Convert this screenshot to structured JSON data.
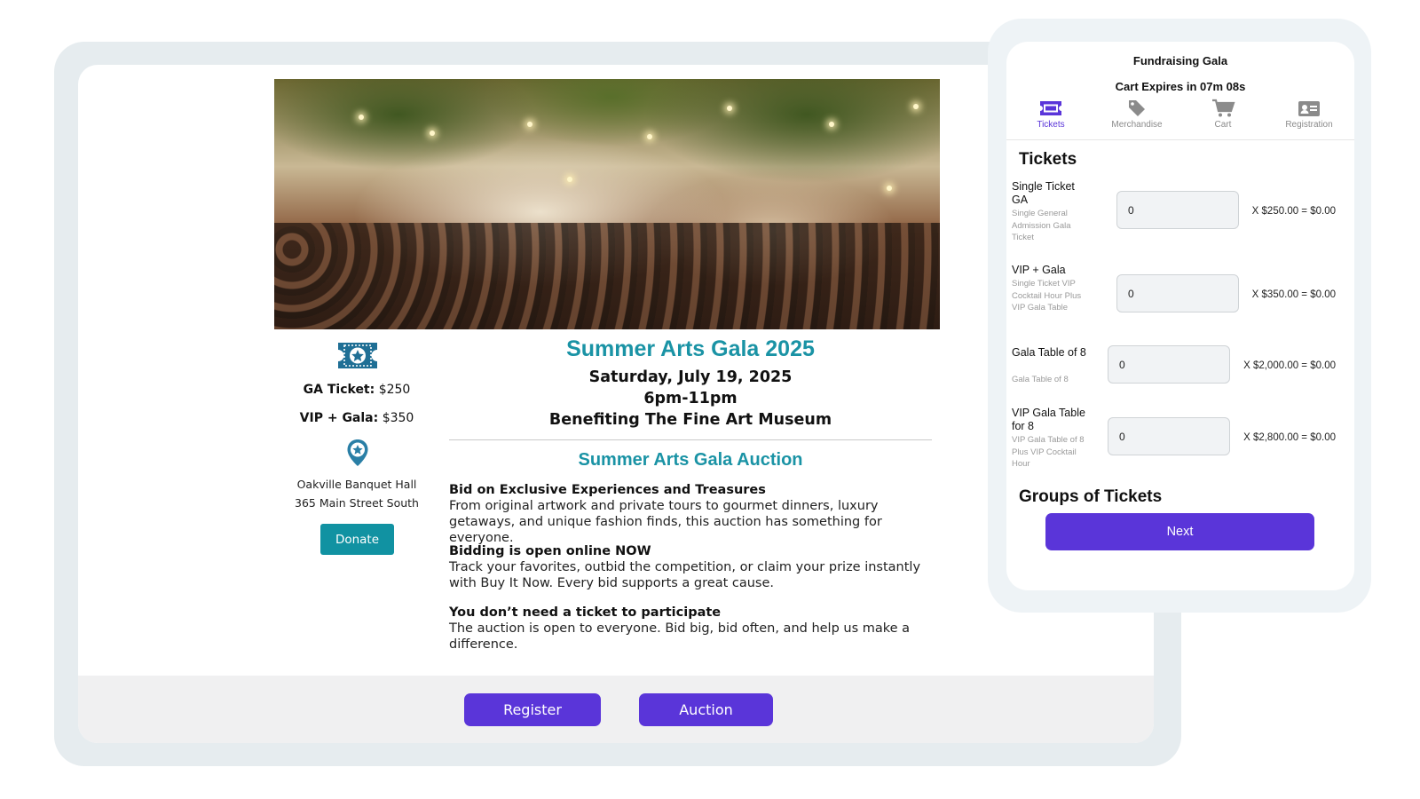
{
  "event": {
    "ga_ticket_label": "GA Ticket:",
    "ga_ticket_price": "$250",
    "vip_gala_label": "VIP + Gala:",
    "vip_gala_price": "$350",
    "venue_name": "Oakville Banquet Hall",
    "venue_address": "365 Main Street South",
    "donate_label": "Donate",
    "title": "Summer Arts Gala 2025",
    "date": "Saturday, July 19, 2025",
    "time": "6pm-11pm",
    "benefit": "Benefiting The Fine Art Museum",
    "auction_title": "Summer Arts Gala Auction",
    "paragraphs": [
      {
        "heading": "Bid on Exclusive Experiences and Treasures",
        "body": "From original artwork and private tours to gourmet dinners, luxury getaways, and unique fashion finds, this auction has something for everyone."
      },
      {
        "heading": "Bidding is open online NOW",
        "body": "Track your favorites, outbid the competition, or claim your prize instantly with Buy It Now. Every bid supports a great cause."
      },
      {
        "heading": "You don’t need a ticket to participate",
        "body": "The auction is open to everyone. Bid big, bid often, and help us make a difference."
      }
    ],
    "register_label": "Register",
    "auction_label": "Auction"
  },
  "widget": {
    "title": "Fundraising Gala",
    "cart_expiry": "Cart Expires in 07m 08s",
    "tabs": [
      {
        "label": "Tickets",
        "icon": "ticket-icon"
      },
      {
        "label": "Merchandise",
        "icon": "tag-icon"
      },
      {
        "label": "Cart",
        "icon": "cart-icon"
      },
      {
        "label": "Registration",
        "icon": "id-card-icon"
      }
    ],
    "active_tab": "Tickets",
    "tickets_heading": "Tickets",
    "tickets": [
      {
        "name": "Single Ticket GA",
        "desc": "Single General Admission Gala Ticket",
        "qty": "0",
        "calc": "X $250.00 = $0.00"
      },
      {
        "name": "VIP + Gala",
        "desc": "Single Ticket VIP Cocktail Hour Plus VIP Gala Table",
        "qty": "0",
        "calc": "X $350.00 = $0.00"
      },
      {
        "name": "Gala Table of 8",
        "desc": "Gala Table of 8",
        "qty": "0",
        "calc": "X $2,000.00 = $0.00"
      },
      {
        "name": "VIP Gala Table for 8",
        "desc": "VIP Gala Table of 8 Plus VIP Cocktail Hour",
        "qty": "0",
        "calc": "X $2,800.00 = $0.00"
      }
    ],
    "groups_heading": "Groups of Tickets",
    "next_label": "Next"
  },
  "colors": {
    "accent_teal": "#1a93a5",
    "button_purple": "#5a35d9",
    "donate_teal": "#1192a2"
  }
}
